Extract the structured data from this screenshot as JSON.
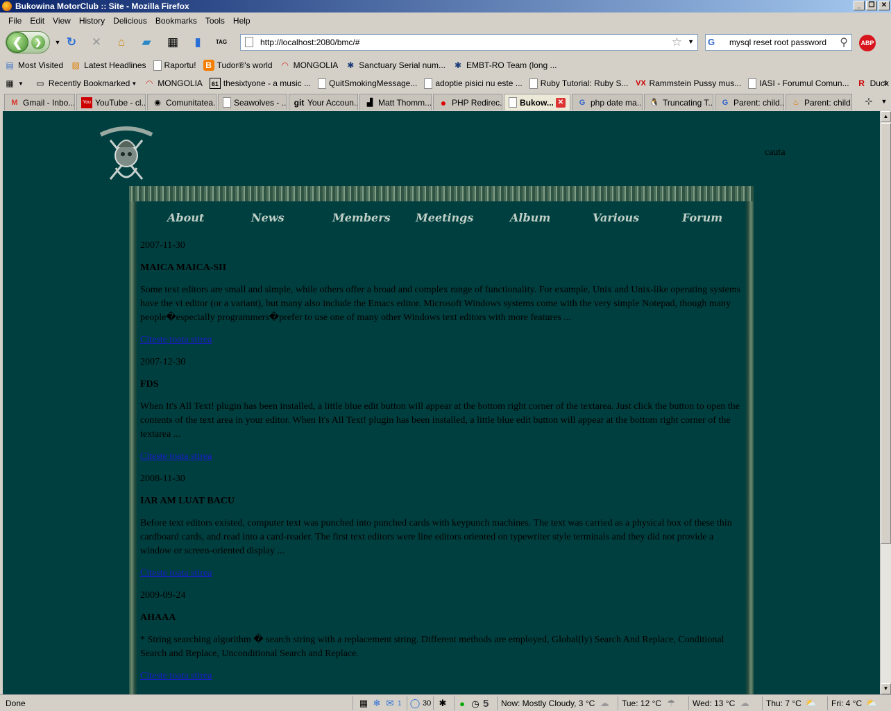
{
  "window": {
    "title": "Bukowina MotorClub :: Site - Mozilla Firefox"
  },
  "menu": [
    "File",
    "Edit",
    "View",
    "History",
    "Delicious",
    "Bookmarks",
    "Tools",
    "Help"
  ],
  "toolbar": {
    "url": "http://localhost:2080/bmc/#",
    "search_value": "mysql reset root password",
    "abp_label": "ABP",
    "tag_label": "TAG"
  },
  "bookmarks_row1": [
    {
      "label": "Most Visited",
      "icon": "most-visited-icon"
    },
    {
      "label": "Latest Headlines",
      "icon": "rss-icon"
    },
    {
      "label": "Raportu!",
      "icon": "page-icon"
    },
    {
      "label": "Tudor®'s world",
      "icon": "blogger-icon"
    },
    {
      "label": "MONGOLIA",
      "icon": "rainbow-icon"
    },
    {
      "label": "Sanctuary Serial num...",
      "icon": "star-icon"
    },
    {
      "label": "EMBT-RO Team (long ...",
      "icon": "star-icon"
    }
  ],
  "bookmarks_row2": [
    {
      "label": "Recently Bookmarked",
      "icon": "folder-icon"
    },
    {
      "label": "MONGOLIA",
      "icon": "rainbow-icon"
    },
    {
      "label": "thesixtyone - a music ...",
      "icon": "sixtyone-icon"
    },
    {
      "label": "QuitSmokingMessage...",
      "icon": "page-icon"
    },
    {
      "label": "adoptie pisici nu este ...",
      "icon": "page-icon"
    },
    {
      "label": "Ruby Tutorial: Ruby S...",
      "icon": "page-icon"
    },
    {
      "label": "Rammstein Pussy mus...",
      "icon": "vx-icon"
    },
    {
      "label": "IASI - Forumul Comun...",
      "icon": "page-icon"
    },
    {
      "label": "Duck Typing: Ruby St...",
      "icon": "r-icon"
    }
  ],
  "tabs": [
    {
      "label": "Gmail - Inbo...",
      "icon": "gmail-icon"
    },
    {
      "label": "YouTube - cl...",
      "icon": "youtube-icon"
    },
    {
      "label": "Comunitatea...",
      "icon": "community-icon"
    },
    {
      "label": "Seawolves - ...",
      "icon": "page-icon"
    },
    {
      "label": "Your Accoun...",
      "icon": "git-icon"
    },
    {
      "label": "Matt Thomm...",
      "icon": "page-icon"
    },
    {
      "label": "PHP Redirec...",
      "icon": "red-dot-icon"
    },
    {
      "label": "Bukow...",
      "icon": "page-icon",
      "active": true
    },
    {
      "label": "php date ma...",
      "icon": "google-icon"
    },
    {
      "label": "Truncating T...",
      "icon": "tux-icon"
    },
    {
      "label": "Parent: child...",
      "icon": "google-icon"
    },
    {
      "label": "Parent: child...",
      "icon": "java-icon"
    }
  ],
  "page": {
    "search_label": "cauta",
    "nav": [
      "About",
      "News",
      "Members",
      "Meetings",
      "Album",
      "Various",
      "Forum"
    ],
    "articles": [
      {
        "date": "2007-11-30",
        "title": "MAICA MAICA-SII",
        "text": "Some text editors are small and simple, while others offer a broad and complex range of functionality. For example, Unix and Unix-like operating systems have the vi editor (or a variant), but many also include the Emacs editor. Microsoft Windows systems come with the very simple Notepad, though many people�especially programmers�prefer to use one of many other Windows text editors with more features ...",
        "link": "Citeste toata stirea"
      },
      {
        "date": "2007-12-30",
        "title": "FDS",
        "text": "When It's All Text! plugin has been installed, a little blue edit button will appear at the bottom right corner of the textarea. Just click the button to open the contents of the text area in your editor. When It's All Text! plugin has been installed, a little blue edit button will appear at the bottom right corner of the textarea ...",
        "link": "Citeste toata stirea"
      },
      {
        "date": "2008-11-30",
        "title": "IAR AM LUAT BACU",
        "text": "Before text editors existed, computer text was punched into punched cards with keypunch machines. The text was carried as a physical box of these thin cardboard cards, and read into a card-reader. The first text editors were line editors oriented on typewriter style terminals and they did not provide a window or screen-oriented display ...",
        "link": "Citeste toata stirea"
      },
      {
        "date": "2009-09-24",
        "title": "AHAAA",
        "text": "* String searching algorithm � search string with a replacement string. Different methods are employed, Global(ly) Search And Replace, Conditional Search and Replace, Unconditional Search and Replace.",
        "link": "Citeste toata stirea"
      }
    ]
  },
  "status": {
    "text": "Done",
    "mail_count": "1",
    "chat_count": "30",
    "counter": "5",
    "weather_now": "Now: Mostly Cloudy, 3 °C",
    "weather_tue": "Tue: 12 °C",
    "weather_wed": "Wed: 13 °C",
    "weather_thu": "Thu: 7 °C",
    "weather_fri": "Fri: 4 °C"
  },
  "colors": {
    "page_background": "#003f3f",
    "link": "#1b1bcf",
    "titlebar_start": "#0a246a"
  }
}
